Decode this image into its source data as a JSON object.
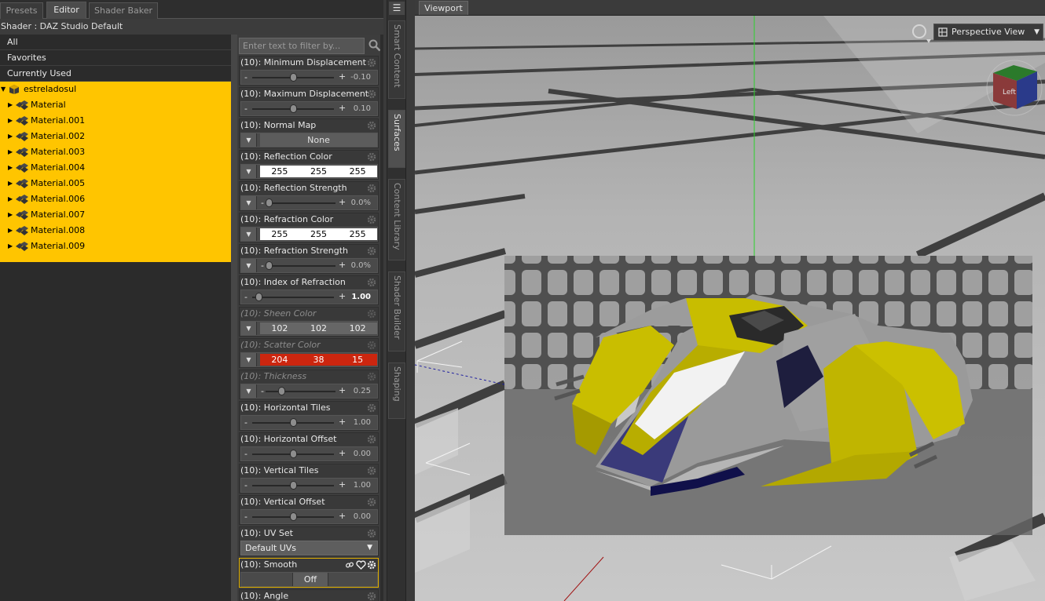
{
  "tabs": {
    "presets": "Presets",
    "editor": "Editor",
    "shader_baker": "Shader Baker"
  },
  "shader_label": "Shader : DAZ Studio Default",
  "filters": [
    "All",
    "Favorites",
    "Currently Used"
  ],
  "tree": {
    "root": "estreladosul",
    "materials": [
      "Material",
      "Material.001",
      "Material.002",
      "Material.003",
      "Material.004",
      "Material.005",
      "Material.006",
      "Material.007",
      "Material.008",
      "Material.009"
    ]
  },
  "filter_placeholder": "Enter text to filter by...",
  "properties": {
    "min_disp": {
      "title": "(10): Minimum Displacement",
      "value": "-0.10",
      "fraction": 0.5
    },
    "max_disp": {
      "title": "(10): Maximum Displacement",
      "value": "0.10",
      "fraction": 0.5
    },
    "normal_map": {
      "title": "(10): Normal Map",
      "value": "None"
    },
    "refl_color": {
      "title": "(10): Reflection Color",
      "r": "255",
      "g": "255",
      "b": "255",
      "hex": "#ffffff"
    },
    "refl_strength": {
      "title": "(10): Reflection Strength",
      "value": "0.0%",
      "fraction": 0.0
    },
    "refr_color": {
      "title": "(10): Refraction Color",
      "r": "255",
      "g": "255",
      "b": "255",
      "hex": "#ffffff"
    },
    "refr_strength": {
      "title": "(10): Refraction Strength",
      "value": "0.0%",
      "fraction": 0.0
    },
    "ior": {
      "title": "(10): Index of Refraction",
      "value": "1.00",
      "fraction": 0.0
    },
    "sheen_color": {
      "title": "(10): Sheen Color",
      "r": "102",
      "g": "102",
      "b": "102",
      "hex": "#666666"
    },
    "scatter_color": {
      "title": "(10): Scatter Color",
      "r": "204",
      "g": "38",
      "b": "15",
      "hex": "#cc260f"
    },
    "thickness": {
      "title": "(10): Thickness",
      "value": "0.25",
      "fraction": 0.2
    },
    "h_tiles": {
      "title": "(10): Horizontal Tiles",
      "value": "1.00",
      "fraction": 0.5
    },
    "h_offset": {
      "title": "(10): Horizontal Offset",
      "value": "0.00",
      "fraction": 0.5
    },
    "v_tiles": {
      "title": "(10): Vertical Tiles",
      "value": "1.00",
      "fraction": 0.5
    },
    "v_offset": {
      "title": "(10): Vertical Offset",
      "value": "0.00",
      "fraction": 0.5
    },
    "uv_set": {
      "title": "(10): UV Set",
      "value": "Default UVs"
    },
    "smooth": {
      "title": "(10): Smooth",
      "value": "Off"
    },
    "angle": {
      "title": "(10): Angle"
    }
  },
  "side_tabs": [
    "Smart Content",
    "Surfaces",
    "Content Library",
    "Shader Builder",
    "Shaping"
  ],
  "viewport": {
    "tab": "Viewport",
    "view": "Perspective View",
    "cube_face": "Left"
  },
  "colors": {
    "accent": "#ffc500",
    "panel": "#3c3c3c",
    "scatter": "#cc260f",
    "ship_yellow": "#c8b400"
  }
}
